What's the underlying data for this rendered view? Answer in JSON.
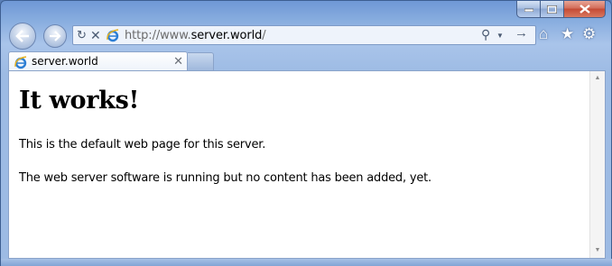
{
  "window": {
    "controls": {
      "minimize": "minimize",
      "maximize": "maximize",
      "close": "close"
    }
  },
  "nav": {
    "url_prefix": "http://www.",
    "url_host": "server.world",
    "url_suffix": "/",
    "icons": [
      "back-icon",
      "forward-icon",
      "refresh-icon",
      "stop-icon",
      "ie-icon",
      "search-icon",
      "go-icon",
      "home-icon",
      "favorites-icon",
      "tools-icon"
    ]
  },
  "tabs": [
    {
      "title": "server.world",
      "active": true
    }
  ],
  "page": {
    "heading": "It works!",
    "paragraph1": "This is the default web page for this server.",
    "paragraph2": "The web server software is running but no content has been added, yet."
  },
  "colors": {
    "frame": "#88addf",
    "close_button": "#c44a35",
    "content_bg": "#ffffff"
  }
}
